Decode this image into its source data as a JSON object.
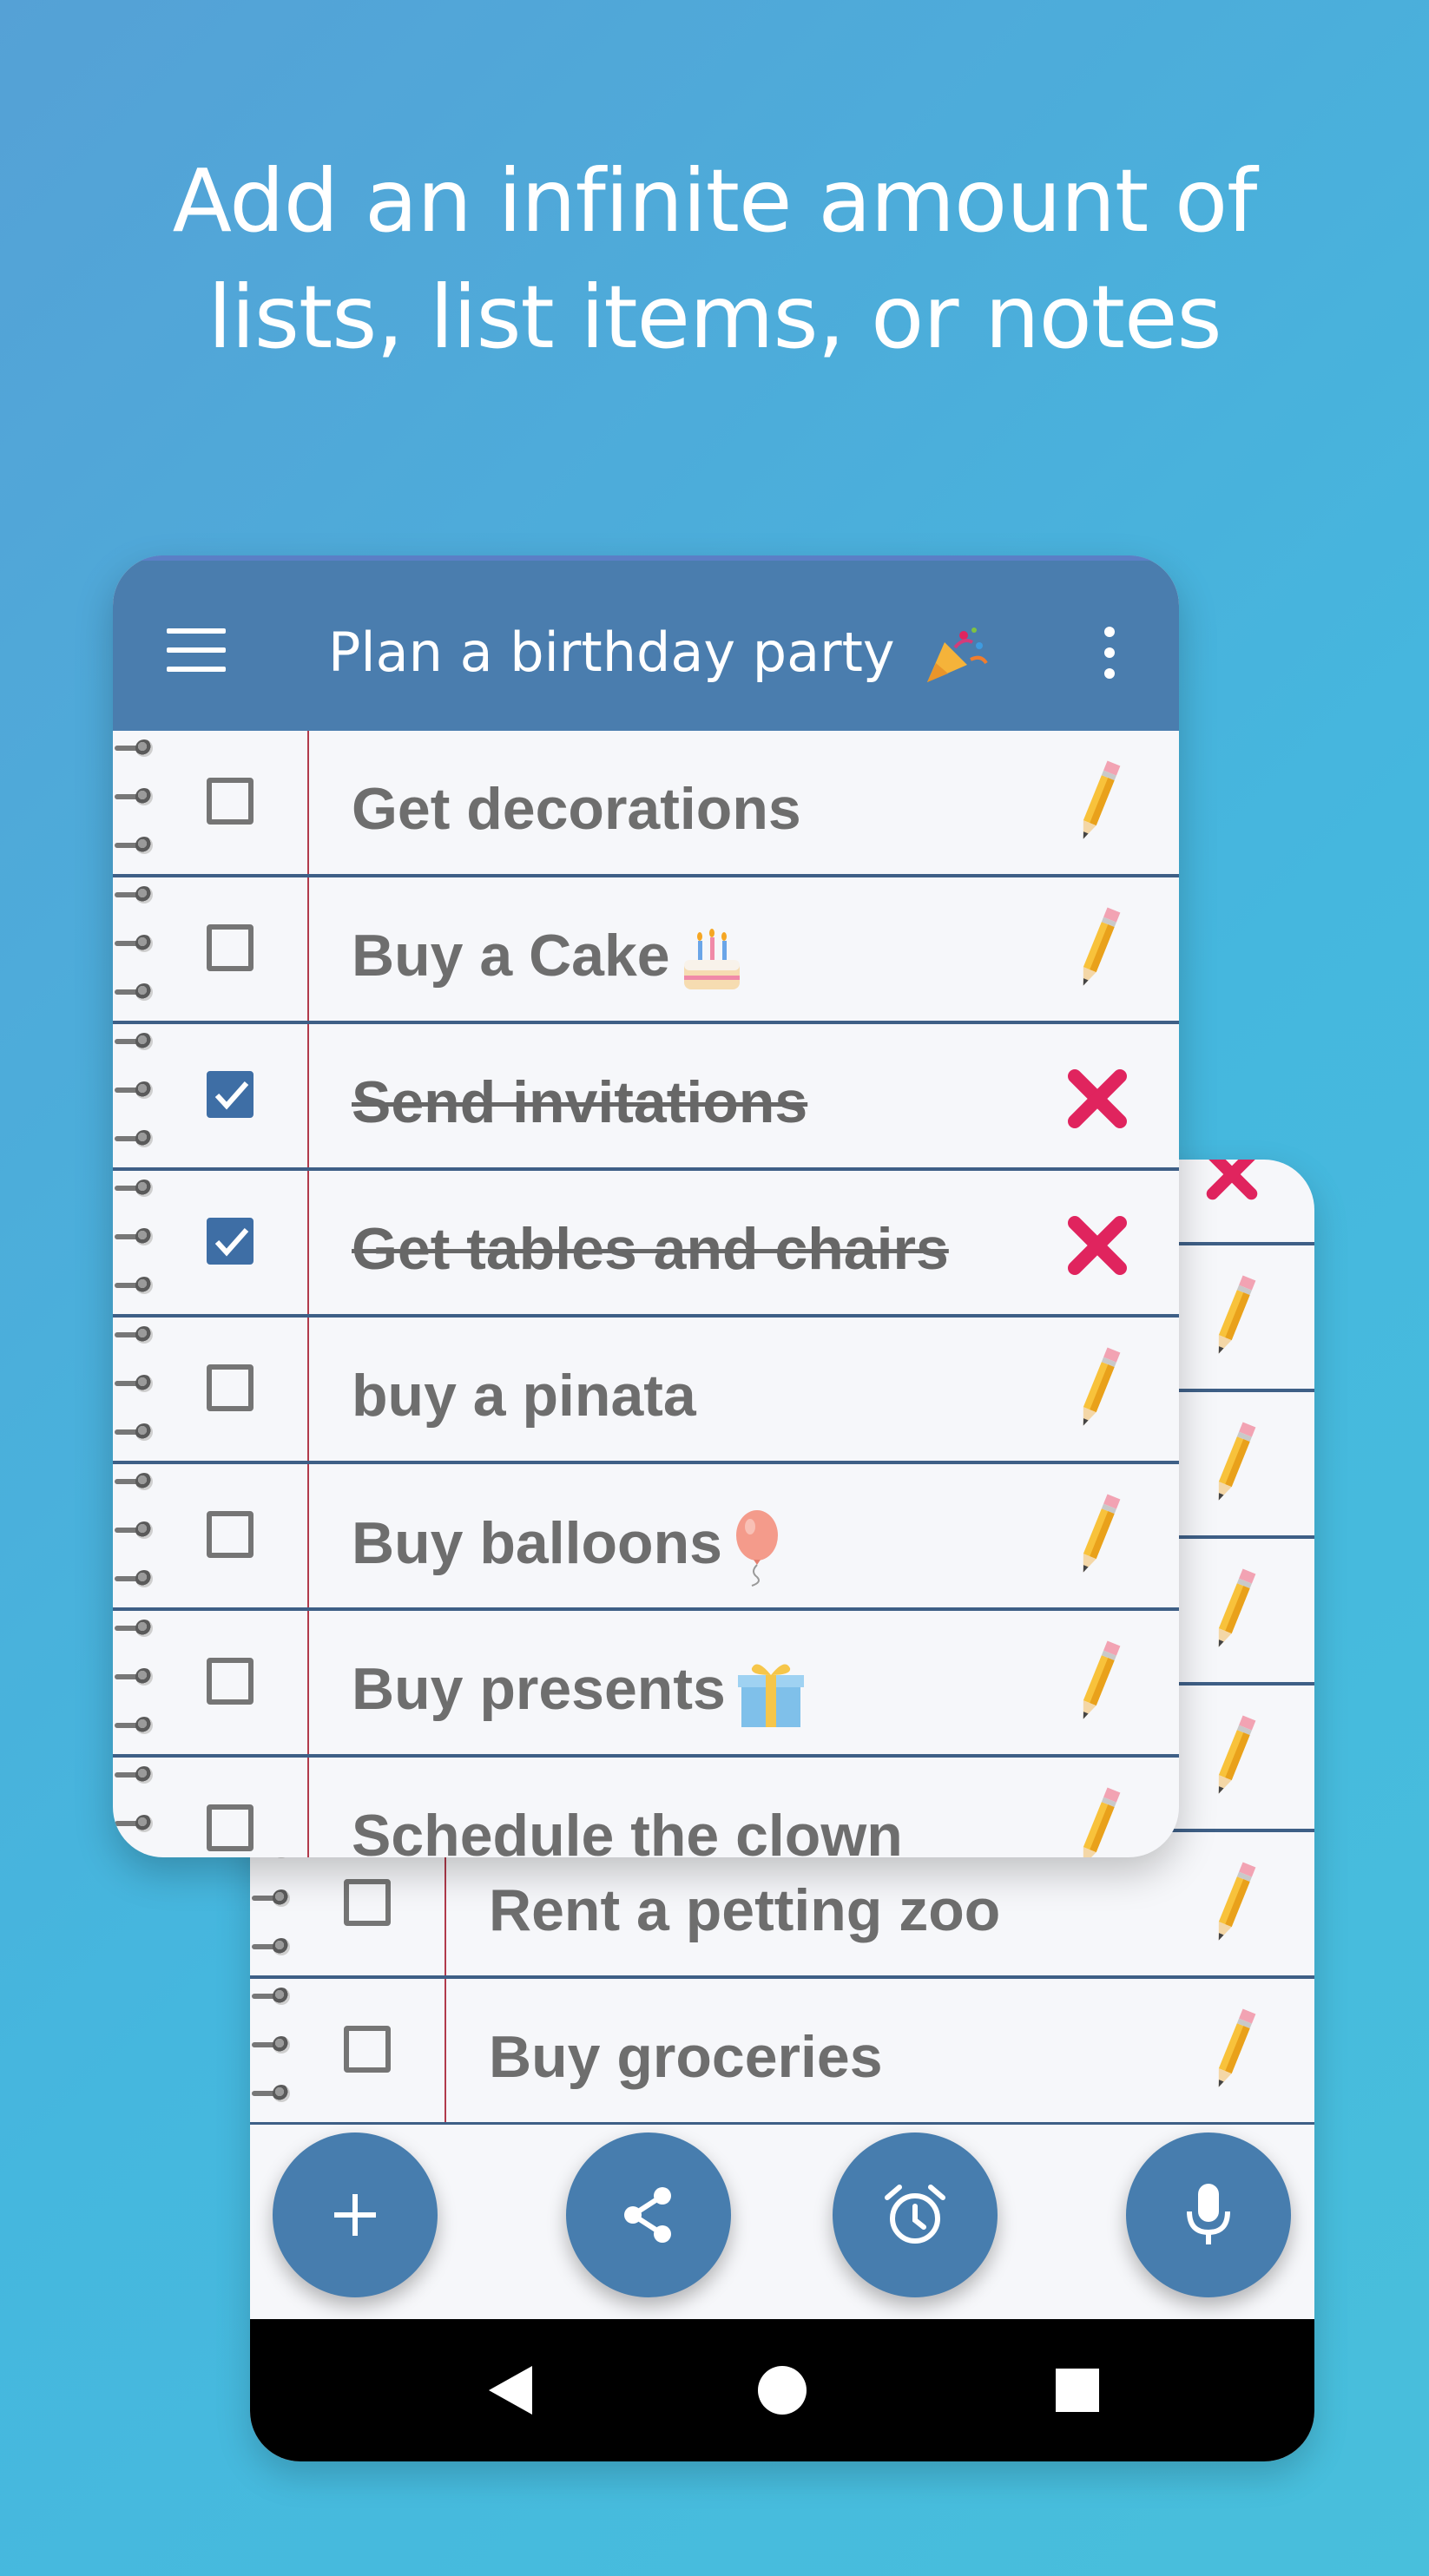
{
  "headline": {
    "line1": "Add an infinite amount of",
    "line2": "lists, list items, or notes"
  },
  "app": {
    "title": "Plan a birthday party",
    "title_emoji": "party-popper-icon"
  },
  "front_list": [
    {
      "text": "Get decorations",
      "checked": false,
      "emoji": ""
    },
    {
      "text": "Buy a Cake",
      "checked": false,
      "emoji": "cake"
    },
    {
      "text": "Send invitations",
      "checked": true,
      "emoji": ""
    },
    {
      "text": "Get tables and chairs",
      "checked": true,
      "emoji": ""
    },
    {
      "text": "buy a pinata",
      "checked": false,
      "emoji": ""
    },
    {
      "text": "Buy balloons",
      "checked": false,
      "emoji": "balloon"
    },
    {
      "text": "Buy presents",
      "checked": false,
      "emoji": "gift"
    },
    {
      "text": "Schedule the clown",
      "checked": false,
      "emoji": ""
    }
  ],
  "back_list": [
    {
      "text": "Rent a petting zoo",
      "checked": false
    },
    {
      "text": "Buy groceries",
      "checked": false
    }
  ],
  "fabs": [
    "add",
    "share",
    "alarm",
    "microphone"
  ],
  "nav": [
    "back",
    "home",
    "recents"
  ],
  "colors": {
    "background": "#4bb3df",
    "appbar": "#4a7dae",
    "fab": "#477dae",
    "checked": "#3e6ea5",
    "delete": "#e0245e",
    "margin_line": "#b13a4b",
    "row_line": "#3e5f86"
  }
}
